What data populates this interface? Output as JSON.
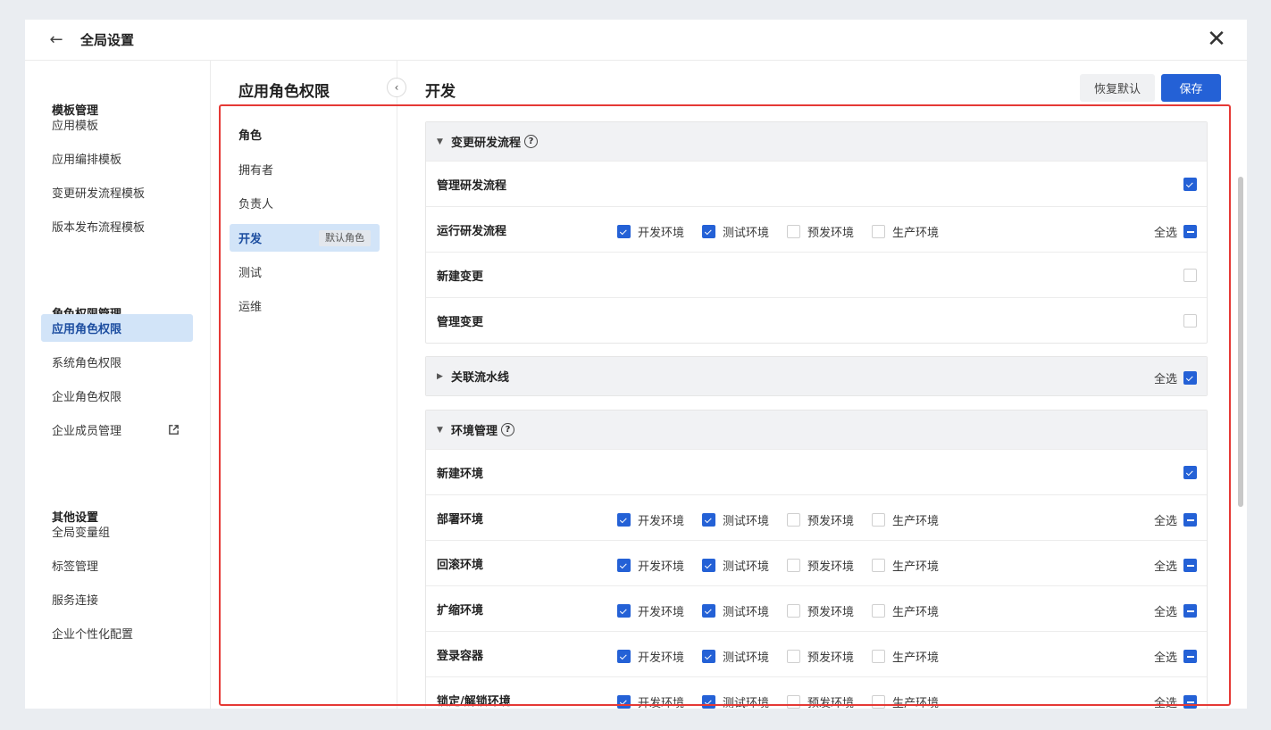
{
  "window": {
    "title": "全局设置"
  },
  "nav": {
    "groups": [
      {
        "title": "模板管理",
        "items": [
          "应用模板",
          "应用编排模板",
          "变更研发流程模板",
          "版本发布流程模板"
        ]
      },
      {
        "title": "角色权限管理",
        "items": [
          "应用角色权限",
          "系统角色权限",
          "企业角色权限",
          "企业成员管理"
        ]
      },
      {
        "title": "其他设置",
        "items": [
          "全局变量组",
          "标签管理",
          "服务连接",
          "企业个性化配置"
        ]
      }
    ],
    "active": "应用角色权限"
  },
  "roles": {
    "title": "应用角色权限",
    "header": "角色",
    "items": [
      "拥有者",
      "负责人",
      "开发",
      "测试",
      "运维"
    ],
    "active": "开发",
    "default_badge": "默认角色"
  },
  "main": {
    "title": "开发",
    "reset_label": "恢复默认",
    "save_label": "保存",
    "select_all_label": "全选",
    "env_options": [
      "开发环境",
      "测试环境",
      "预发环境",
      "生产环境"
    ],
    "sections": [
      {
        "title": "变更研发流程",
        "expanded": true,
        "rows": [
          {
            "label": "管理研发流程",
            "type": "single",
            "checked": true
          },
          {
            "label": "运行研发流程",
            "type": "env",
            "envs": [
              true,
              true,
              false,
              false
            ],
            "all": "mixed"
          },
          {
            "label": "新建变更",
            "type": "single",
            "checked": false
          },
          {
            "label": "管理变更",
            "type": "single",
            "checked": false
          }
        ]
      },
      {
        "title": "关联流水线",
        "expanded": false,
        "all": "on"
      },
      {
        "title": "环境管理",
        "expanded": true,
        "rows": [
          {
            "label": "新建环境",
            "type": "single",
            "checked": true
          },
          {
            "label": "部署环境",
            "type": "env",
            "envs": [
              true,
              true,
              false,
              false
            ],
            "all": "mixed"
          },
          {
            "label": "回滚环境",
            "type": "env",
            "envs": [
              true,
              true,
              false,
              false
            ],
            "all": "mixed"
          },
          {
            "label": "扩缩环境",
            "type": "env",
            "envs": [
              true,
              true,
              false,
              false
            ],
            "all": "mixed"
          },
          {
            "label": "登录容器",
            "type": "env",
            "envs": [
              true,
              true,
              false,
              false
            ],
            "all": "mixed"
          },
          {
            "label": "锁定/解锁环境",
            "type": "env",
            "envs": [
              true,
              true,
              false,
              false
            ],
            "all": "mixed"
          }
        ]
      }
    ]
  },
  "colors": {
    "accent": "#2461d6",
    "active_bg": "#d2e4f8",
    "highlight_box": "#e53935"
  }
}
